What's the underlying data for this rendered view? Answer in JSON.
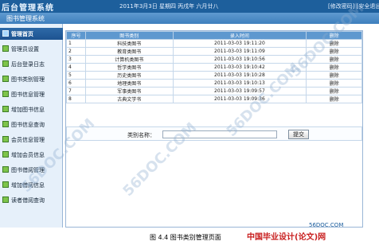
{
  "header": {
    "logo": "后台管理系统",
    "system_title": "图书管理系统",
    "date_text": "2011年3月3日 星期四 丙戌年 六月廿八",
    "top_link": "[修改密码] [安全退出]"
  },
  "sidebar": {
    "items": [
      {
        "label": "管理首页"
      },
      {
        "label": "管理员设置"
      },
      {
        "label": "后台登录日志"
      },
      {
        "label": "图书类别管理"
      },
      {
        "label": "图书信息管理"
      },
      {
        "label": "增加图书信息"
      },
      {
        "label": "图书信息查询"
      },
      {
        "label": "会员信息管理"
      },
      {
        "label": "增加会员信息"
      },
      {
        "label": "图书借阅管理"
      },
      {
        "label": "增加借阅信息"
      },
      {
        "label": "读者借阅查询"
      }
    ]
  },
  "table": {
    "headers": [
      "序号",
      "图书类别",
      "录入时间",
      "删除"
    ],
    "rows": [
      {
        "no": "1",
        "category": "科技类图书",
        "time": "2011-03-03 19:11:20",
        "action": "删除"
      },
      {
        "no": "2",
        "category": "教育类图书",
        "time": "2011-03-03 19:11:09",
        "action": "删除"
      },
      {
        "no": "3",
        "category": "计算机类图书",
        "time": "2011-03-03 19:10:56",
        "action": "删除"
      },
      {
        "no": "4",
        "category": "哲学类图书",
        "time": "2011-03-03 19:10:42",
        "action": "删除"
      },
      {
        "no": "5",
        "category": "历史类图书",
        "time": "2011-03-03 19:10:28",
        "action": "删除"
      },
      {
        "no": "6",
        "category": "地理类图书",
        "time": "2011-03-03 19:10:13",
        "action": "删除"
      },
      {
        "no": "7",
        "category": "军事类图书",
        "time": "2011-03-03 19:09:57",
        "action": "删除"
      },
      {
        "no": "8",
        "category": "古典文学书",
        "time": "2011-03-03 19:09:36",
        "action": "删除"
      }
    ]
  },
  "search": {
    "label": "类别名称：",
    "value": "",
    "button": "提交"
  },
  "caption": "图 4.4 图书类别管理页面",
  "watermarks": {
    "site_cn": "中国毕业设计(论文)网",
    "site_url": "56DOC.COM"
  }
}
